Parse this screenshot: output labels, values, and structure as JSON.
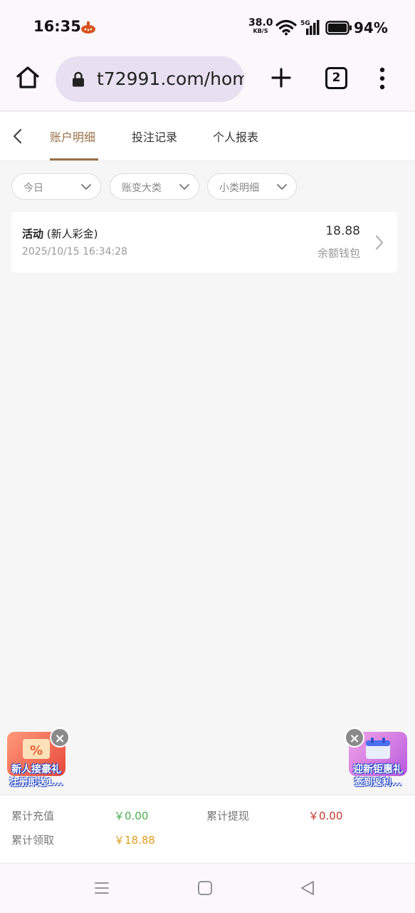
{
  "status_bar": {
    "time": "16:35",
    "net_speed_value": "38.0",
    "net_speed_unit": "KB/S",
    "signal_label": "5G",
    "battery": "94%"
  },
  "browser": {
    "url": "t72991.com/hom",
    "tab_count": "2"
  },
  "tabs": [
    {
      "label": "账户明细",
      "active": true
    },
    {
      "label": "投注记录",
      "active": false
    },
    {
      "label": "个人报表",
      "active": false
    }
  ],
  "filters": [
    {
      "label": "今日"
    },
    {
      "label": "账变大类"
    },
    {
      "label": "小类明细"
    }
  ],
  "records": [
    {
      "type": "活动",
      "subtype": "(新人彩金)",
      "time": "2025/10/15 16:34:28",
      "amount": "18.88",
      "wallet": "余额钱包"
    }
  ],
  "promos": {
    "left": {
      "line1": "新人接豪礼",
      "line2": "注册即送1..."
    },
    "right": {
      "line1": "迎新钜惠礼",
      "line2": "签到返利..."
    },
    "close_glyph": "×"
  },
  "summary": {
    "recharge_label": "累计充值",
    "recharge_value": "￥0.00",
    "withdraw_label": "累计提现",
    "withdraw_value": "￥0.00",
    "claim_label": "累计领取",
    "claim_value": "￥18.88"
  },
  "colors": {
    "accent": "#9a7048",
    "recharge": "#4caf50",
    "withdraw": "#c0392b",
    "claim": "#e0a020"
  }
}
